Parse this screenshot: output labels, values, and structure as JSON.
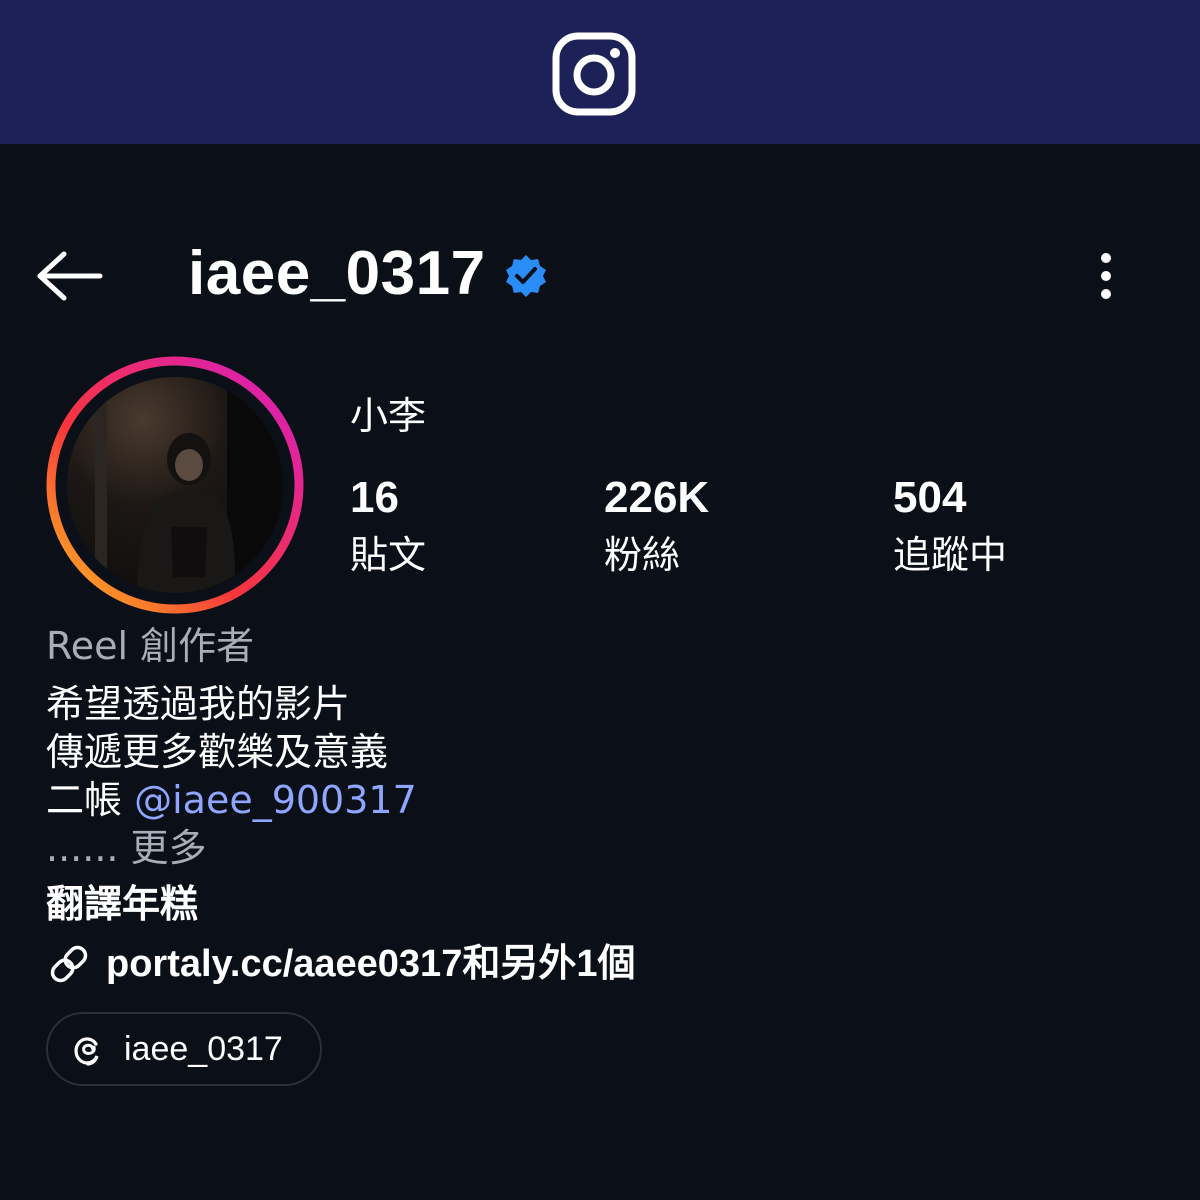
{
  "app": {
    "logo_icon": "instagram-icon",
    "brand_bar_color": "#1c2257"
  },
  "header": {
    "back_icon": "arrow-left-icon",
    "username": "iaee_0317",
    "verified_icon": "verified-badge-icon",
    "verified_color": "#2a8cf7",
    "more_icon": "vertical-dots-icon"
  },
  "profile": {
    "avatar": "profile-photo",
    "display_name": "小李",
    "stats": [
      {
        "value": "16",
        "label": "貼文"
      },
      {
        "value": "226K",
        "label": "粉絲"
      },
      {
        "value": "504",
        "label": "追蹤中"
      }
    ],
    "category": "Reel 創作者",
    "bio_lines": [
      "希望透過我的影片",
      "傳遞更多歡樂及意義"
    ],
    "second_account_prefix": "二帳 ",
    "second_account_mention": "@iaee_900317",
    "more_text": "...... 更多",
    "translate_label": "翻譯年糕",
    "link_icon": "link-icon",
    "link_text": "portaly.cc/aaee0317和另外1個",
    "threads_icon": "threads-icon",
    "threads_handle": "iaee_0317"
  }
}
